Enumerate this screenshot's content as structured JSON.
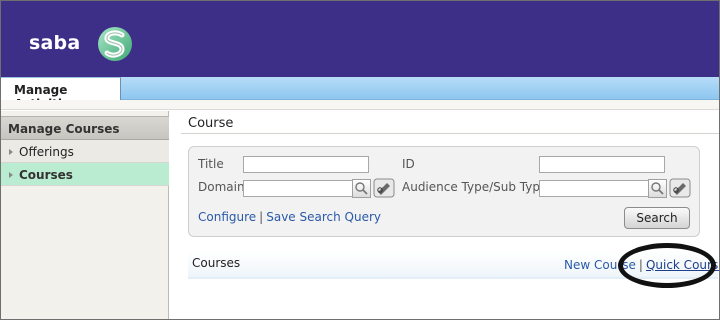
{
  "header": {
    "logo_text": "saba",
    "brand_color": "#3d2f87"
  },
  "tabs": {
    "active_label": "Manage Activities"
  },
  "sidebar": {
    "heading": "Manage Courses",
    "items": [
      {
        "label": "Offerings",
        "selected": false
      },
      {
        "label": "Courses",
        "selected": true
      }
    ],
    "selected_color": "#b9ecd1"
  },
  "main": {
    "title": "Course",
    "search": {
      "title_label": "Title",
      "id_label": "ID",
      "domain_label": "Domain",
      "audience_label": "Audience Type/Sub Type",
      "title_value": "",
      "id_value": "",
      "domain_value": "",
      "audience_value": "",
      "configure_link": "Configure",
      "save_query_link": "Save Search Query",
      "search_button": "Search"
    },
    "results": {
      "label": "Courses",
      "new_course_link": "New Course",
      "quick_course_link": "Quick Course",
      "separator": "|"
    }
  },
  "icons": [
    "saba-logo-icon",
    "chevron-right-icon",
    "search-icon",
    "picker-icon"
  ]
}
